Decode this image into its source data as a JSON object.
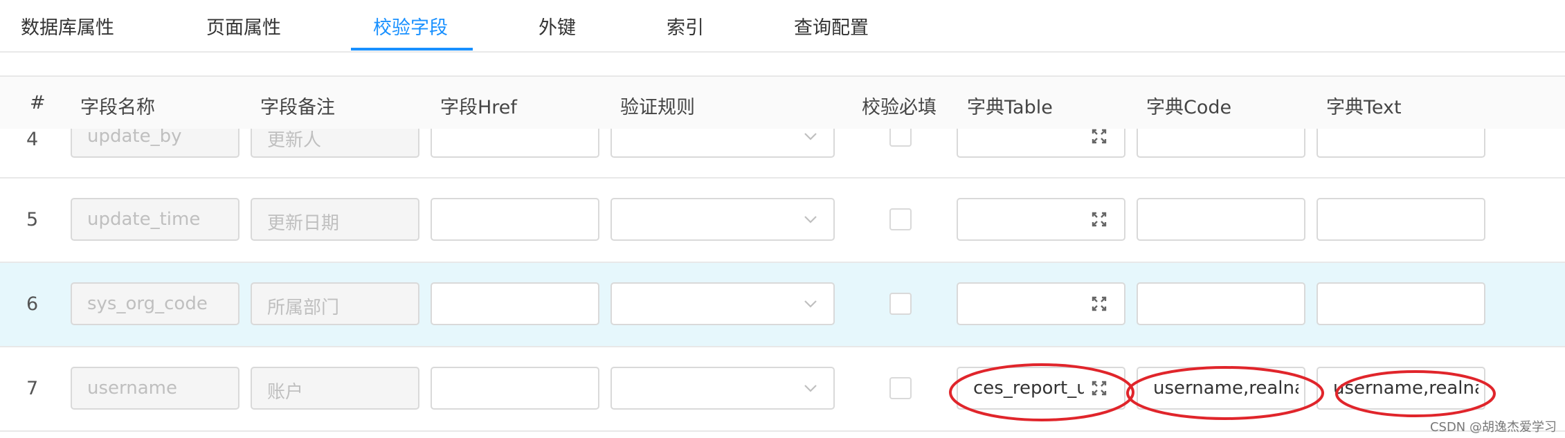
{
  "tabs": [
    {
      "label": "数据库属性"
    },
    {
      "label": "页面属性"
    },
    {
      "label": "校验字段",
      "active": true
    },
    {
      "label": "外键"
    },
    {
      "label": "索引"
    },
    {
      "label": "查询配置"
    }
  ],
  "columns": [
    "#",
    "字段名称",
    "字段备注",
    "字段Href",
    "验证规则",
    "校验必填",
    "字典Table",
    "字典Code",
    "字典Text"
  ],
  "rows": [
    {
      "num": "4",
      "field_name": "update_by",
      "field_comment": "更新人",
      "href": "",
      "rule": "",
      "required": false,
      "dict_table": "",
      "dict_code": "",
      "dict_text": ""
    },
    {
      "num": "5",
      "field_name": "update_time",
      "field_comment": "更新日期",
      "href": "",
      "rule": "",
      "required": false,
      "dict_table": "",
      "dict_code": "",
      "dict_text": ""
    },
    {
      "num": "6",
      "field_name": "sys_org_code",
      "field_comment": "所属部门",
      "href": "",
      "rule": "",
      "required": false,
      "dict_table": "",
      "dict_code": "",
      "dict_text": "",
      "highlighted": true
    },
    {
      "num": "7",
      "field_name": "username",
      "field_comment": "账户",
      "href": "",
      "rule": "",
      "required": false,
      "dict_table": "ces_report_us",
      "dict_code": "username,realna",
      "dict_text": "username,realna"
    }
  ],
  "colors": {
    "accent": "#1890ff",
    "highlight_row": "#e6f7fc",
    "annotation": "#e0252b"
  },
  "icons": {
    "select_arrow": "chevron-down-icon",
    "dict_table_picker": "expand-icon"
  },
  "watermark": "CSDN @胡逸杰爱学习"
}
